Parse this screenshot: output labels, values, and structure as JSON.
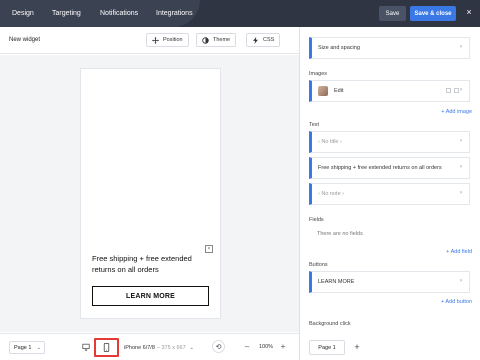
{
  "topbar": {
    "tabs": [
      {
        "label": "Design"
      },
      {
        "label": "Targeting"
      },
      {
        "label": "Notifications"
      },
      {
        "label": "Integrations"
      }
    ],
    "save_label": "Save",
    "save_close_label": "Save & close",
    "close_symbol": "×"
  },
  "editor": {
    "widget_name": "New widget",
    "position_label": "Position",
    "theme_label": "Theme",
    "css_label": "CSS"
  },
  "preview": {
    "close_symbol": "×",
    "promo_text": "Free shipping + free extended returns on all orders",
    "button_label": "LEARN MORE"
  },
  "bottombar": {
    "page_select": "Page 1",
    "device": "iPhone 6/7/8",
    "device_size": "– 375 x 667",
    "zoom": "100%",
    "zoom_minus": "–",
    "zoom_plus": "+"
  },
  "panel": {
    "size_spacing": "Size and spacing",
    "images_label": "Images",
    "image_item": "Edit",
    "add_image": "+ Add image",
    "text_label": "Text",
    "text_items": [
      {
        "label": "‹ No title ›",
        "placeholder": true
      },
      {
        "label": "Free shipping + free extended returns on all orders",
        "placeholder": false
      },
      {
        "label": "‹ No note ›",
        "placeholder": true
      }
    ],
    "fields_label": "Fields",
    "fields_empty": "There are no fields",
    "add_field": "+ Add field",
    "buttons_label": "Buttons",
    "button_item": "LEARN MORE",
    "add_button": "+ Add button",
    "background_click_label": "Background click",
    "page_tab": "Page 1",
    "page_add": "+"
  },
  "colors": {
    "topbar": "#2f3542",
    "accent": "#3a78e6",
    "highlight": "#e53935"
  }
}
